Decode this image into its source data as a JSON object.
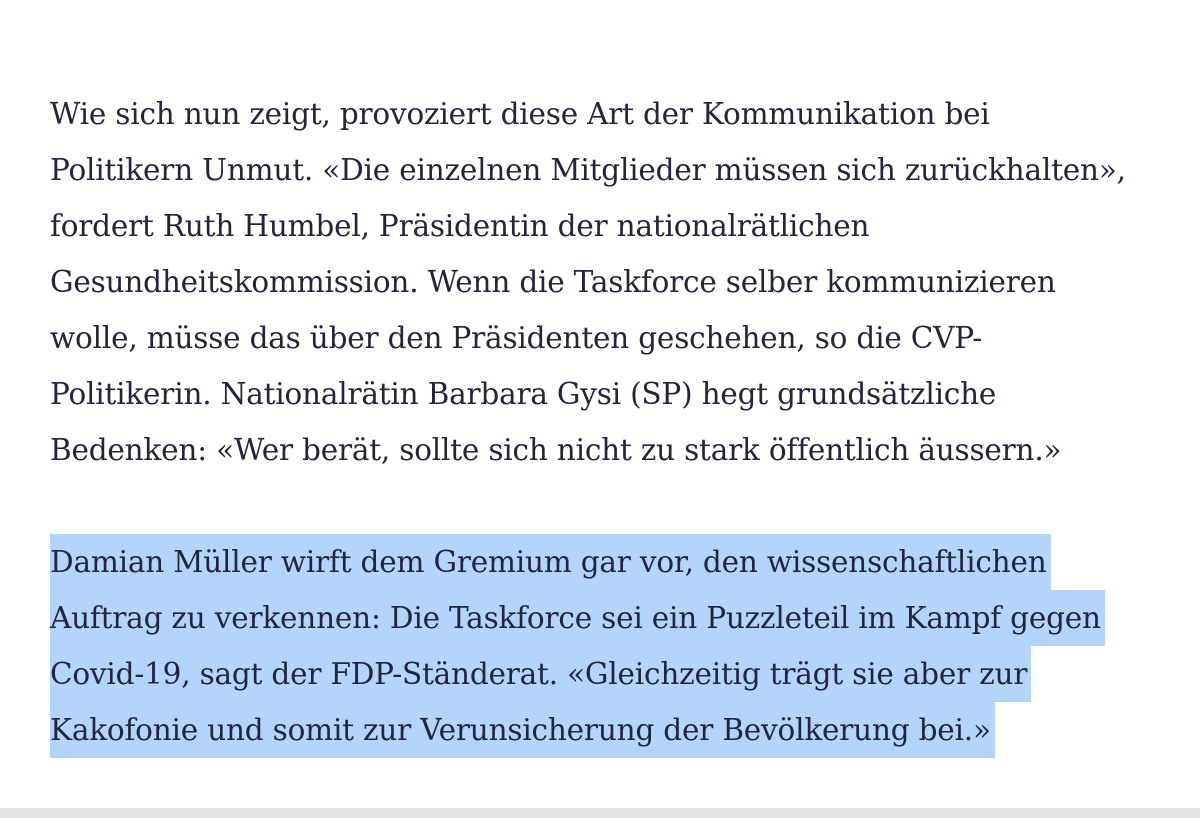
{
  "article": {
    "paragraph_1": [
      "Wie sich nun zeigt, provoziert diese Art der Kommunikation bei",
      "Politikern Unmut. «Die einzelnen Mitglieder müssen sich zurückhalten»,",
      "fordert Ruth Humbel, Präsidentin der nationalrätlichen",
      "Gesundheitskommission. Wenn die Taskforce selber kommunizieren",
      "wolle, müsse das über den Präsidenten geschehen, so die CVP-",
      "Politikerin. Nationalrätin Barbara Gysi (SP) hegt grundsätzliche",
      "Bedenken: «Wer berät, sollte sich nicht zu stark öffentlich äussern.»"
    ],
    "paragraph_2_selected": [
      "Damian Müller wirft dem Gremium gar vor, den wissenschaftlichen",
      "Auftrag zu verkennen: Die Taskforce sei ein Puzzleteil im Kampf gegen",
      "Covid-19, sagt der FDP-Ständerat. «Gleichzeitig trägt sie aber zur",
      "Kakofonie und somit zur Verunsicherung der Bevölkerung bei.»"
    ]
  },
  "colors": {
    "text": "#23253f",
    "selection": "#b4d5fb",
    "background": "#ffffff"
  }
}
